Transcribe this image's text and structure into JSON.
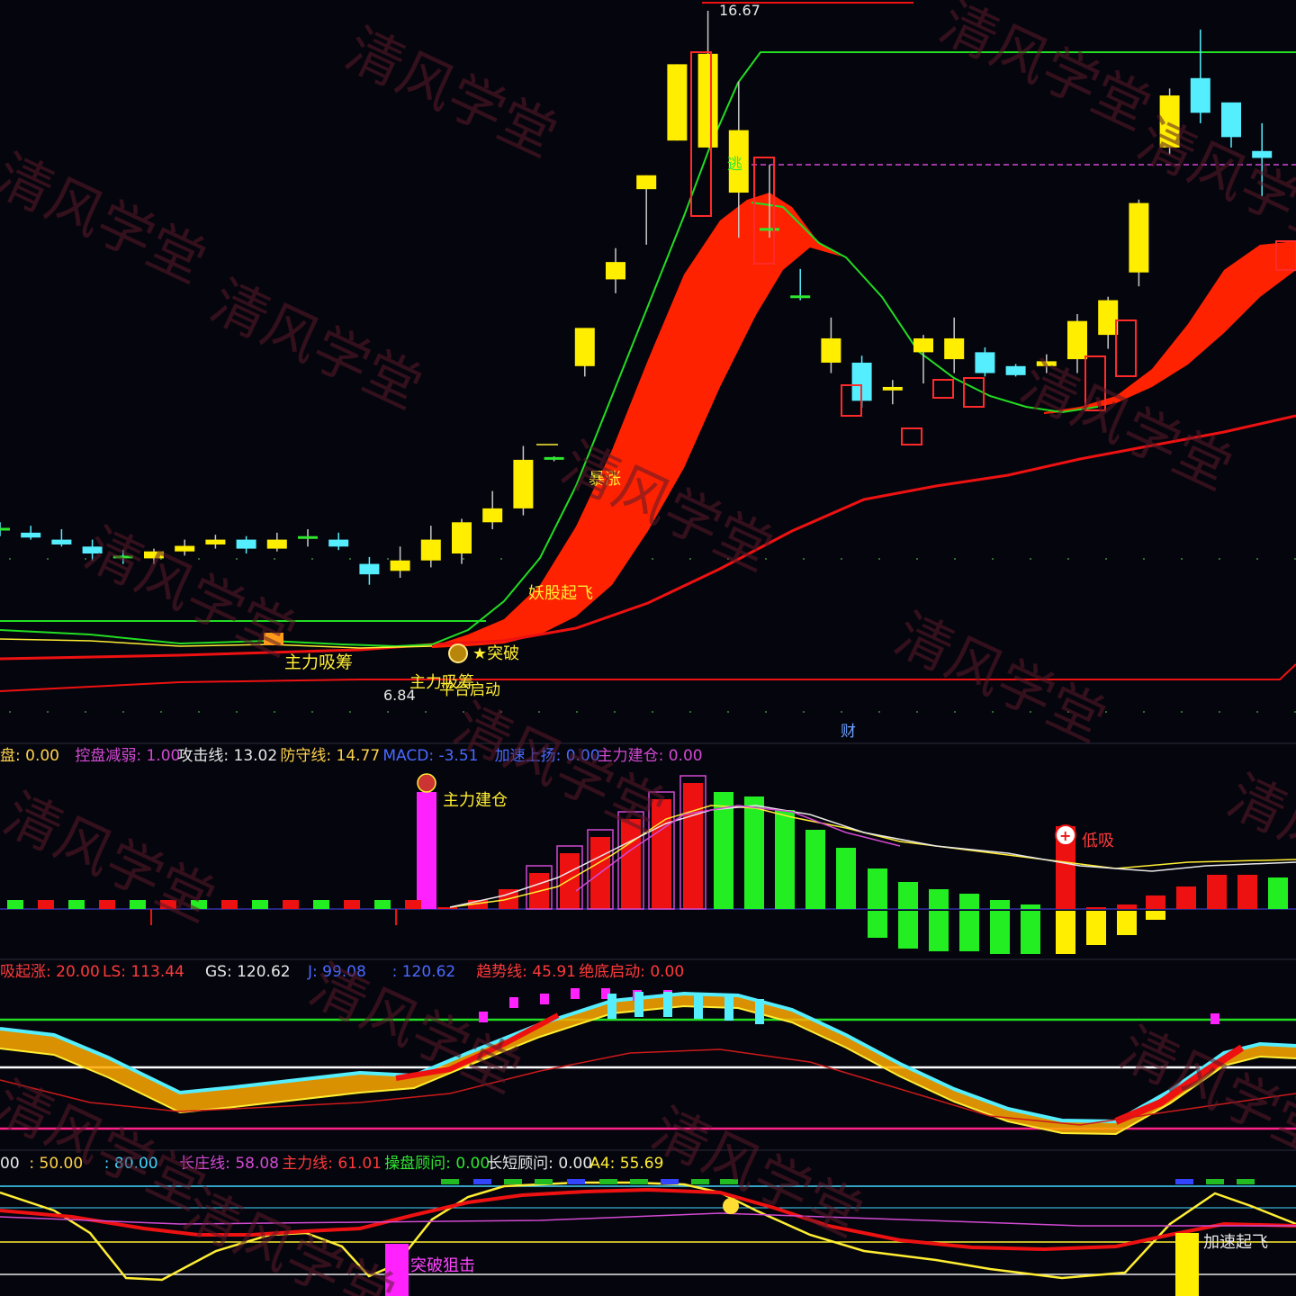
{
  "watermark": "清风学堂",
  "main_labels": {
    "high_price": "16.67",
    "low_price": "6.84",
    "escape": "逃",
    "surge": "暴涨",
    "demon": "妖股起飞",
    "breakout": "★突破",
    "main_accumulate": "主力吸筹",
    "main_buy": "主力吸筹",
    "main_start": "平台启动",
    "cai": "财"
  },
  "legend2": [
    {
      "text": "盘: 0.00",
      "color": "#ffd24a"
    },
    {
      "text": "控盘减弱: 1.00",
      "color": "#d24ad2"
    },
    {
      "text": "攻击线: 13.02",
      "color": "#e8e8e8"
    },
    {
      "text": "防守线: 14.77",
      "color": "#ffd24a"
    },
    {
      "text": "MACD: -3.51",
      "color": "#4a6aff"
    },
    {
      "text": "加速上扬: 0.00",
      "color": "#4a6aff"
    },
    {
      "text": "主力建仓: 0.00",
      "color": "#d24ad2"
    }
  ],
  "panel2_labels": {
    "jiancang": "主力建仓",
    "dixi": "低吸"
  },
  "legend3": [
    {
      "text": "吸起涨: 20.00",
      "color": "#ff3a3a"
    },
    {
      "text": "LS: 113.44",
      "color": "#ff3a3a"
    },
    {
      "text": "GS: 120.62",
      "color": "#e8e8e8"
    },
    {
      "text": "J: 99.08",
      "color": "#4a6aff"
    },
    {
      "text": ": 120.62",
      "color": "#4a6aff"
    },
    {
      "text": "趋势线: 45.91",
      "color": "#ff3a3a"
    },
    {
      "text": "绝底启动: 0.00",
      "color": "#ff3a3a"
    }
  ],
  "legend4": [
    {
      "text": "00",
      "color": "#e8e8e8"
    },
    {
      "text": ": 50.00",
      "color": "#ffd24a"
    },
    {
      "text": ": 80.00",
      "color": "#44d8ff"
    },
    {
      "text": "长庄线: 58.08",
      "color": "#d24ad2"
    },
    {
      "text": "主力线: 61.01",
      "color": "#ff3a3a"
    },
    {
      "text": "操盘顾问: 0.00",
      "color": "#2ee82e"
    },
    {
      "text": "长短顾问: 0.00",
      "color": "#e8e8e8"
    },
    {
      "text": "A4: 55.69",
      "color": "#ffee33"
    }
  ],
  "panel4_labels": {
    "tupo": "突破狙击",
    "jiasu": "加速起飞"
  },
  "colors": {
    "bg": "#05050d",
    "up_yellow": "#ffee00",
    "down_cyan": "#55eeff",
    "ribbon": "#ff2200",
    "green": "#22dd22",
    "red": "#ee1111",
    "magenta": "#ff22ff",
    "grid": "#1e1e2a"
  },
  "chart_data": {
    "type": "candlestick",
    "price_range": [
      6.84,
      16.67
    ],
    "candles": [
      {
        "o": 9.2,
        "h": 9.3,
        "l": 9.1,
        "c": 9.15
      },
      {
        "o": 9.15,
        "h": 9.25,
        "l": 9.05,
        "c": 9.08
      },
      {
        "o": 9.05,
        "h": 9.2,
        "l": 8.95,
        "c": 8.98
      },
      {
        "o": 8.95,
        "h": 9.05,
        "l": 8.75,
        "c": 8.85
      },
      {
        "o": 8.8,
        "h": 8.9,
        "l": 8.7,
        "c": 8.78
      },
      {
        "o": 8.78,
        "h": 8.92,
        "l": 8.7,
        "c": 8.88
      },
      {
        "o": 8.88,
        "h": 9.05,
        "l": 8.82,
        "c": 8.96
      },
      {
        "o": 8.98,
        "h": 9.12,
        "l": 8.92,
        "c": 9.05
      },
      {
        "o": 9.05,
        "h": 9.1,
        "l": 8.85,
        "c": 8.92
      },
      {
        "o": 8.92,
        "h": 9.15,
        "l": 8.88,
        "c": 9.05
      },
      {
        "o": 9.05,
        "h": 9.2,
        "l": 8.95,
        "c": 9.08
      },
      {
        "o": 9.05,
        "h": 9.15,
        "l": 8.9,
        "c": 8.95
      },
      {
        "o": 8.7,
        "h": 8.8,
        "l": 8.4,
        "c": 8.55
      },
      {
        "o": 8.6,
        "h": 8.95,
        "l": 8.5,
        "c": 8.75
      },
      {
        "o": 8.75,
        "h": 9.25,
        "l": 8.65,
        "c": 9.05
      },
      {
        "o": 8.85,
        "h": 9.35,
        "l": 8.7,
        "c": 9.3
      },
      {
        "o": 9.3,
        "h": 9.75,
        "l": 9.2,
        "c": 9.5
      },
      {
        "o": 9.5,
        "h": 10.4,
        "l": 9.4,
        "c": 10.2
      },
      {
        "o": 10.2,
        "h": 10.25,
        "l": 10.18,
        "c": 10.22
      },
      {
        "o": 11.55,
        "h": 12.1,
        "l": 11.4,
        "c": 12.1
      },
      {
        "o": 12.8,
        "h": 13.25,
        "l": 12.6,
        "c": 13.05
      },
      {
        "o": 14.1,
        "h": 14.3,
        "l": 13.3,
        "c": 14.3
      },
      {
        "o": 14.8,
        "h": 15.9,
        "l": 14.8,
        "c": 15.9
      },
      {
        "o": 14.7,
        "h": 16.67,
        "l": 14.7,
        "c": 16.05
      },
      {
        "o": 14.05,
        "h": 15.65,
        "l": 13.4,
        "c": 14.95
      },
      {
        "o": 13.5,
        "h": 14.45,
        "l": 13.4,
        "c": 13.52
      },
      {
        "o": 12.55,
        "h": 12.95,
        "l": 12.5,
        "c": 12.52
      },
      {
        "o": 11.6,
        "h": 12.25,
        "l": 11.45,
        "c": 11.95
      },
      {
        "o": 11.6,
        "h": 11.7,
        "l": 10.95,
        "c": 11.05
      },
      {
        "o": 11.2,
        "h": 11.35,
        "l": 11.0,
        "c": 11.25
      },
      {
        "o": 11.75,
        "h": 12.0,
        "l": 11.3,
        "c": 11.95
      },
      {
        "o": 11.65,
        "h": 12.25,
        "l": 11.45,
        "c": 11.95
      },
      {
        "o": 11.75,
        "h": 11.82,
        "l": 11.4,
        "c": 11.45
      },
      {
        "o": 11.55,
        "h": 11.58,
        "l": 11.4,
        "c": 11.42
      },
      {
        "o": 11.55,
        "h": 11.72,
        "l": 11.45,
        "c": 11.62
      },
      {
        "o": 11.65,
        "h": 12.3,
        "l": 11.45,
        "c": 12.2
      },
      {
        "o": 12.0,
        "h": 12.55,
        "l": 11.8,
        "c": 12.5
      },
      {
        "o": 12.9,
        "h": 13.95,
        "l": 12.7,
        "c": 13.9
      },
      {
        "o": 14.7,
        "h": 15.55,
        "l": 14.6,
        "c": 15.45
      },
      {
        "o": 15.7,
        "h": 16.4,
        "l": 15.05,
        "c": 15.2
      },
      {
        "o": 15.35,
        "h": 15.3,
        "l": 14.7,
        "c": 14.85
      },
      {
        "o": 14.65,
        "h": 15.05,
        "l": 14.0,
        "c": 14.55
      }
    ]
  }
}
